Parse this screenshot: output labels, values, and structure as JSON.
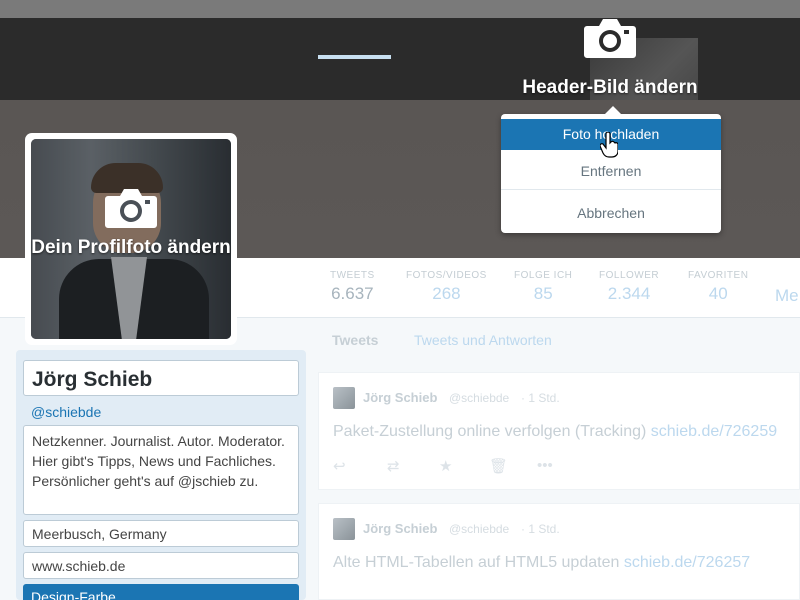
{
  "header": {
    "change_label": "Header-Bild ändern",
    "icon": "camera-icon"
  },
  "header_menu": {
    "upload": "Foto hochladen",
    "remove": "Entfernen",
    "cancel": "Abbrechen"
  },
  "avatar": {
    "change_label": "Dein Profilfoto ändern",
    "icon": "camera-icon"
  },
  "stats": [
    {
      "label": "TWEETS",
      "value": "6.637"
    },
    {
      "label": "FOTOS/VIDEOS",
      "value": "268"
    },
    {
      "label": "FOLGE ICH",
      "value": "85"
    },
    {
      "label": "FOLLOWER",
      "value": "2.344"
    },
    {
      "label": "FAVORITEN",
      "value": "40"
    }
  ],
  "nav_more": "Me",
  "profile": {
    "name": "Jörg Schieb",
    "handle": "@schiebde",
    "bio_lines": [
      "Netzkenner. Journalist. Autor. Moderator.",
      "Hier gibt's Tipps, News und Fachliches.",
      "Persönlicher geht's auf @jschieb zu."
    ],
    "location": "Meerbusch, Germany",
    "website": "www.schieb.de",
    "design_color_label": "Design-Farbe"
  },
  "timeline_tabs": {
    "tweets": "Tweets",
    "replies": "Tweets und Antworten"
  },
  "tweets": [
    {
      "name": "Jörg Schieb",
      "handle": "@schiebde",
      "time": "· 1 Std.",
      "text": "Paket-Zustellung online verfolgen (Tracking) ",
      "link": "schieb.de/726259"
    },
    {
      "name": "Jörg Schieb",
      "handle": "@schiebde",
      "time": "· 1 Std.",
      "text": "Alte HTML-Tabellen auf HTML5 updaten ",
      "link": "schieb.de/726257"
    }
  ],
  "colors": {
    "accent": "#1b75b3",
    "panel": "#e1ecf5"
  }
}
